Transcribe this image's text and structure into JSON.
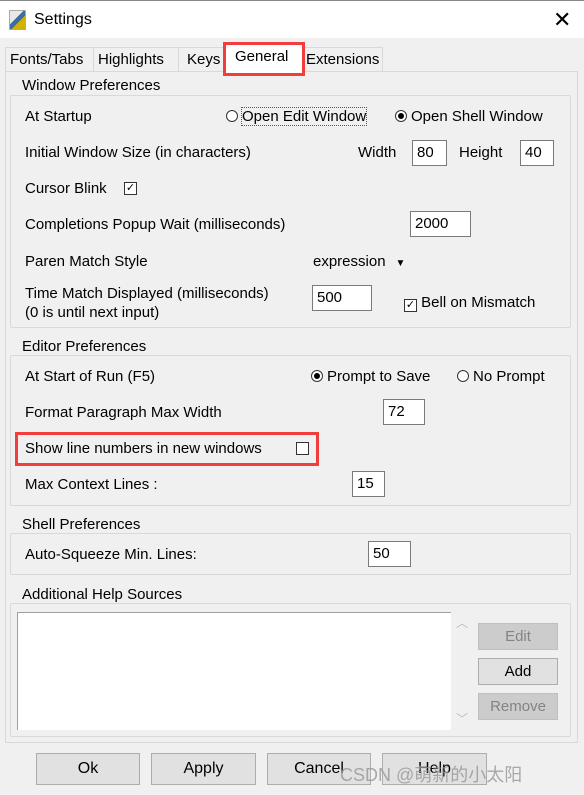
{
  "window": {
    "title": "Settings",
    "app_icon": "python-idle-icon",
    "close_icon": "close-icon"
  },
  "tabs": [
    {
      "label": "Fonts/Tabs"
    },
    {
      "label": "Highlights"
    },
    {
      "label": "Keys"
    },
    {
      "label": "General",
      "selected": true
    },
    {
      "label": "Extensions"
    }
  ],
  "window_prefs": {
    "title": "Window Preferences",
    "at_startup_label": "At Startup",
    "open_edit": "Open Edit Window",
    "open_shell": "Open Shell Window",
    "startup_selected": "Open Shell Window",
    "init_size_label": "Initial Window Size  (in characters)",
    "width_label": "Width",
    "width_value": "80",
    "height_label": "Height",
    "height_value": "40",
    "cursor_blink_label": "Cursor Blink",
    "cursor_blink_checked": true,
    "completions_label": "Completions Popup Wait (milliseconds)",
    "completions_value": "2000",
    "paren_label": "Paren Match Style",
    "paren_value": "expression",
    "time_match_label": "Time Match Displayed (milliseconds)",
    "time_match_sub": "(0 is until next input)",
    "time_match_value": "500",
    "bell_label": "Bell on Mismatch",
    "bell_checked": true
  },
  "editor_prefs": {
    "title": "Editor Preferences",
    "start_run_label": "At Start of Run (F5)",
    "prompt_save": "Prompt to Save",
    "no_prompt": "No Prompt",
    "run_selected": "Prompt to Save",
    "format_label": "Format Paragraph Max Width",
    "format_value": "72",
    "line_numbers_label": "Show line numbers in new windows",
    "line_numbers_checked": false,
    "context_label": "Max Context Lines :",
    "context_value": "15"
  },
  "shell_prefs": {
    "title": "Shell Preferences",
    "squeeze_label": "Auto-Squeeze Min. Lines:",
    "squeeze_value": "50"
  },
  "help_sources": {
    "title": "Additional Help Sources",
    "items": [],
    "edit": "Edit",
    "add": "Add",
    "remove": "Remove"
  },
  "buttons": {
    "ok": "Ok",
    "apply": "Apply",
    "cancel": "Cancel",
    "help": "Help"
  },
  "watermark": "CSDN @萌新的小太阳",
  "colors": {
    "highlight": "#f33d3d",
    "background": "#f0f0f0"
  }
}
